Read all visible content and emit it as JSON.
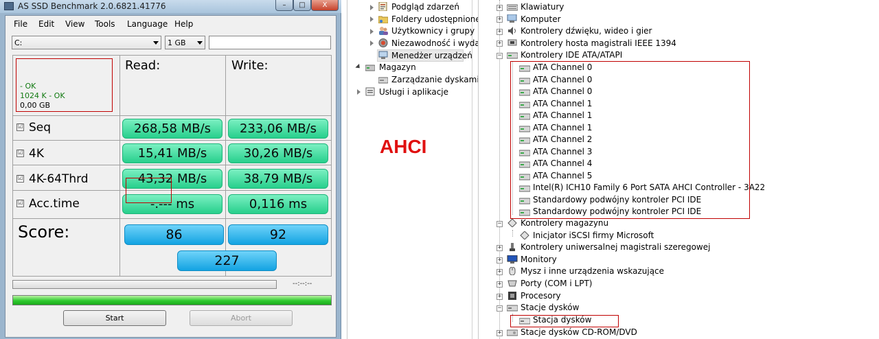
{
  "ssd": {
    "title": "AS SSD Benchmark 2.0.6821.41776",
    "window_controls": {
      "minimize": "–",
      "maximize": "□",
      "close": "X"
    },
    "menu": [
      "File",
      "Edit",
      "View",
      "Tools",
      "Language",
      "Help"
    ],
    "drive": "C:",
    "size": "1 GB",
    "info": {
      "line1": "- OK",
      "line2": "1024 K - OK",
      "line3": "0,00 GB"
    },
    "headers": {
      "read": "Read:",
      "write": "Write:"
    },
    "rows": [
      {
        "label": "Seq",
        "checked": "☑",
        "read": "268,58 MB/s",
        "write": "233,06 MB/s"
      },
      {
        "label": "4K",
        "checked": "☑",
        "read": "15,41 MB/s",
        "write": "30,26 MB/s"
      },
      {
        "label": "4K-64Thrd",
        "checked": "☑",
        "read": "43,32 MB/s",
        "write": "38,79 MB/s"
      },
      {
        "label": "Acc.time",
        "checked": "☑",
        "read": "-.--- ms",
        "write": "0,116 ms"
      }
    ],
    "score_label": "Score:",
    "score_read": "86",
    "score_write": "92",
    "score_total": "227",
    "time": "--:--:--",
    "buttons": {
      "start": "Start",
      "abort": "Abort"
    },
    "colors": {
      "value_green": "#27cf8c",
      "score_blue": "#13a3e2",
      "highlight_red": "#c00000"
    }
  },
  "cm_tree": [
    {
      "label": "Podgląd zdarzeń",
      "icon": "event-viewer-icon"
    },
    {
      "label": "Foldery udostępnione",
      "icon": "shared-folders-icon"
    },
    {
      "label": "Użytkownicy i grupy lok",
      "icon": "users-icon"
    },
    {
      "label": "Niezawodność i wydajn",
      "icon": "performance-icon"
    },
    {
      "label": "Menedżer urządzeń",
      "icon": "device-manager-icon"
    },
    {
      "label": "Magazyn",
      "icon": "storage-icon"
    },
    {
      "label": "Zarządzanie dyskami",
      "icon": "disk-management-icon"
    },
    {
      "label": "Usługi i aplikacje",
      "icon": "services-icon"
    }
  ],
  "annotation": "AHCI",
  "dm_tree": {
    "categories": [
      "Klawiatury",
      "Komputer",
      "Kontrolery dźwięku, wideo i gier",
      "Kontrolery hosta magistrali IEEE 1394",
      "Kontrolery IDE ATA/ATAPI"
    ],
    "ide_children": [
      "ATA Channel 0",
      "ATA Channel 0",
      "ATA Channel 0",
      "ATA Channel 1",
      "ATA Channel 1",
      "ATA Channel 1",
      "ATA Channel 2",
      "ATA Channel 3",
      "ATA Channel 4",
      "ATA Channel 5",
      "Intel(R) ICH10 Family 6 Port SATA AHCI Controller - 3A22",
      "Standardowy podwójny kontroler PCI IDE",
      "Standardowy podwójny kontroler PCI IDE"
    ],
    "storage_controllers": "Kontrolery magazynu",
    "iscsi": "Inicjator iSCSI firmy Microsoft",
    "more_categories": [
      "Kontrolery uniwersalnej magistrali szeregowej",
      "Monitory",
      "Mysz i inne urządzenia wskazujące",
      "Porty (COM i LPT)",
      "Procesory",
      "Stacje dysków"
    ],
    "disk_drive": "Stacja dysków",
    "cdrom": "Stacje dysków CD-ROM/DVD"
  }
}
